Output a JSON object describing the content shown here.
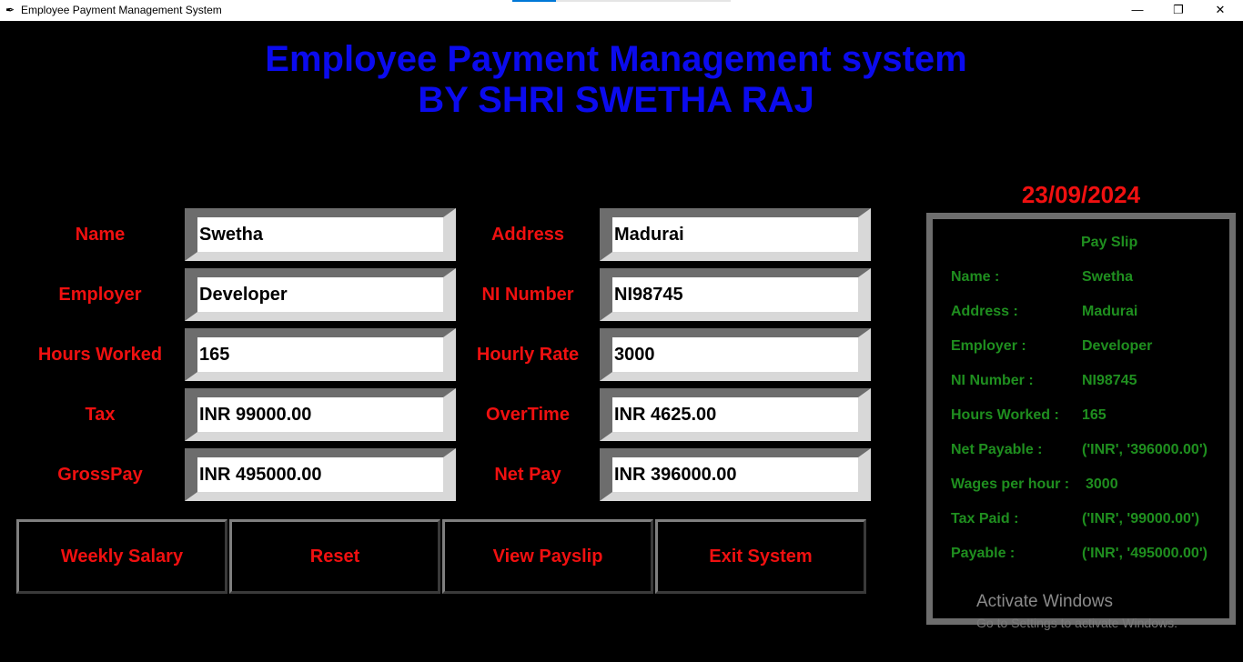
{
  "window": {
    "title": "Employee Payment Management System",
    "icon": "feather-icon",
    "minimize": "—",
    "restore": "❐",
    "close": "✕",
    "taskbar_progress": 0.2
  },
  "header": {
    "line1": "Employee Payment Management system",
    "line2": "BY SHRI SWETHA RAJ"
  },
  "form": {
    "name_label": "Name",
    "name_value": "Swetha",
    "address_label": "Address",
    "address_value": "Madurai",
    "employer_label": "Employer",
    "employer_value": "Developer",
    "ni_label": "NI Number",
    "ni_value": "NI98745",
    "hours_label": "Hours Worked",
    "hours_value": "165",
    "rate_label": "Hourly Rate",
    "rate_value": "3000",
    "tax_label": "Tax",
    "tax_value": "INR 99000.00",
    "overtime_label": "OverTime",
    "overtime_value": "INR 4625.00",
    "gross_label": "GrossPay",
    "gross_value": "INR 495000.00",
    "net_label": "Net Pay",
    "net_value": "INR 396000.00"
  },
  "buttons": {
    "weekly": "Weekly Salary",
    "reset": "Reset",
    "payslip": "View Payslip",
    "exit": "Exit System"
  },
  "date": "23/09/2024",
  "payslip": {
    "title": "Pay Slip",
    "rows": [
      {
        "key": "Name :",
        "value": "Swetha"
      },
      {
        "key": "Address :",
        "value": "Madurai"
      },
      {
        "key": "Employer :",
        "value": "Developer"
      },
      {
        "key": "NI Number :",
        "value": "NI98745"
      },
      {
        "key": "Hours Worked :",
        "value": "165"
      },
      {
        "key": "Net Payable :",
        "value": "('INR', '396000.00')"
      },
      {
        "key": "Wages per hour :",
        "value": "3000"
      },
      {
        "key": "Tax Paid :",
        "value": "('INR', '99000.00')"
      },
      {
        "key": "Payable :",
        "value": "('INR', '495000.00')"
      }
    ]
  },
  "watermark": {
    "line1": "Activate Windows",
    "line2": "Go to Settings to activate Windows."
  }
}
